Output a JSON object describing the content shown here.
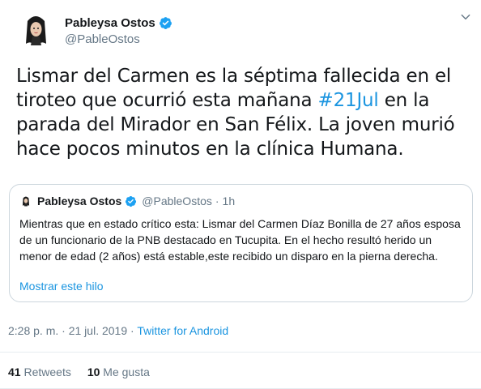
{
  "author": {
    "display_name": "Pableysa Ostos",
    "handle": "@PableOstos",
    "verified": true
  },
  "tweet": {
    "text_before": "Lismar del Carmen es la séptima fallecida en el tiroteo que ocurrió esta mañana ",
    "hashtag": "#21Jul",
    "text_after": " en la parada del Mirador en San Félix. La joven murió hace pocos minutos en la clínica Humana."
  },
  "quoted_tweet": {
    "display_name": "Pableysa Ostos",
    "handle": "@PableOstos",
    "dot": "·",
    "time": "1h",
    "text": "Mientras que en estado crítico esta: Lismar del Carmen Díaz Bonilla de 27 años esposa de un funcionario de la PNB destacado en Tucupita. En el hecho resultó herido un menor de edad (2 años) está estable,este recibido un disparo en la pierna derecha.",
    "show_thread": "Mostrar este hilo"
  },
  "meta": {
    "time": "2:28 p. m.",
    "sep1": " · ",
    "date": "21 jul. 2019",
    "sep2": " · ",
    "source": "Twitter for Android"
  },
  "stats": {
    "retweets_count": "41",
    "retweets_label": "Retweets",
    "likes_count": "10",
    "likes_label": "Me gusta"
  },
  "icons": {
    "verified": "verified-badge-icon",
    "caret": "chevron-down-icon"
  },
  "colors": {
    "accent": "#1b95e0",
    "text": "#14171a",
    "secondary": "#657786",
    "border": "#ccd6dd"
  }
}
